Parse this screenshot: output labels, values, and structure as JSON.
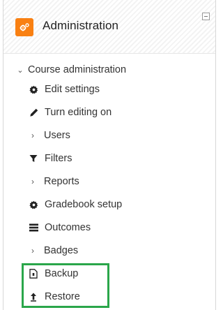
{
  "block": {
    "title": "Administration",
    "icon": "cogs-icon",
    "accent": "#f98012"
  },
  "tree": {
    "root_label": "Course administration",
    "items": [
      {
        "label": "Edit settings",
        "icon": "gear-icon"
      },
      {
        "label": "Turn editing on",
        "icon": "pencil-icon"
      },
      {
        "label": "Users",
        "icon": "chevron-right-icon"
      },
      {
        "label": "Filters",
        "icon": "filter-icon"
      },
      {
        "label": "Reports",
        "icon": "chevron-right-icon"
      },
      {
        "label": "Gradebook setup",
        "icon": "gear-icon"
      },
      {
        "label": "Outcomes",
        "icon": "list-icon"
      },
      {
        "label": "Badges",
        "icon": "chevron-right-icon"
      },
      {
        "label": "Backup",
        "icon": "file-icon"
      },
      {
        "label": "Restore",
        "icon": "upload-icon"
      }
    ]
  },
  "highlight_color": "#2aa64a"
}
